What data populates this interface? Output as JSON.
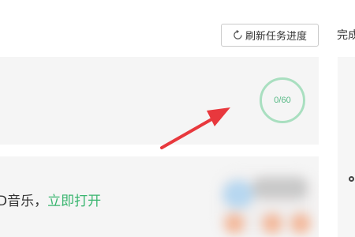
{
  "header": {
    "refresh_button_label": "刷新任务进度",
    "right_tab_label": "完成"
  },
  "task_progress": {
    "text": "0/60",
    "completed": 0,
    "total": 60
  },
  "task_item": {
    "text": "D音乐，",
    "link_label": "立即打开"
  },
  "colors": {
    "accent_green": "#39b56f",
    "progress_ring": "#a9dfc0",
    "arrow_red": "#e8383d",
    "card_bg": "#f5f5f5"
  },
  "icons": {
    "refresh": "refresh-icon",
    "annotation_arrow": "annotation-arrow"
  }
}
